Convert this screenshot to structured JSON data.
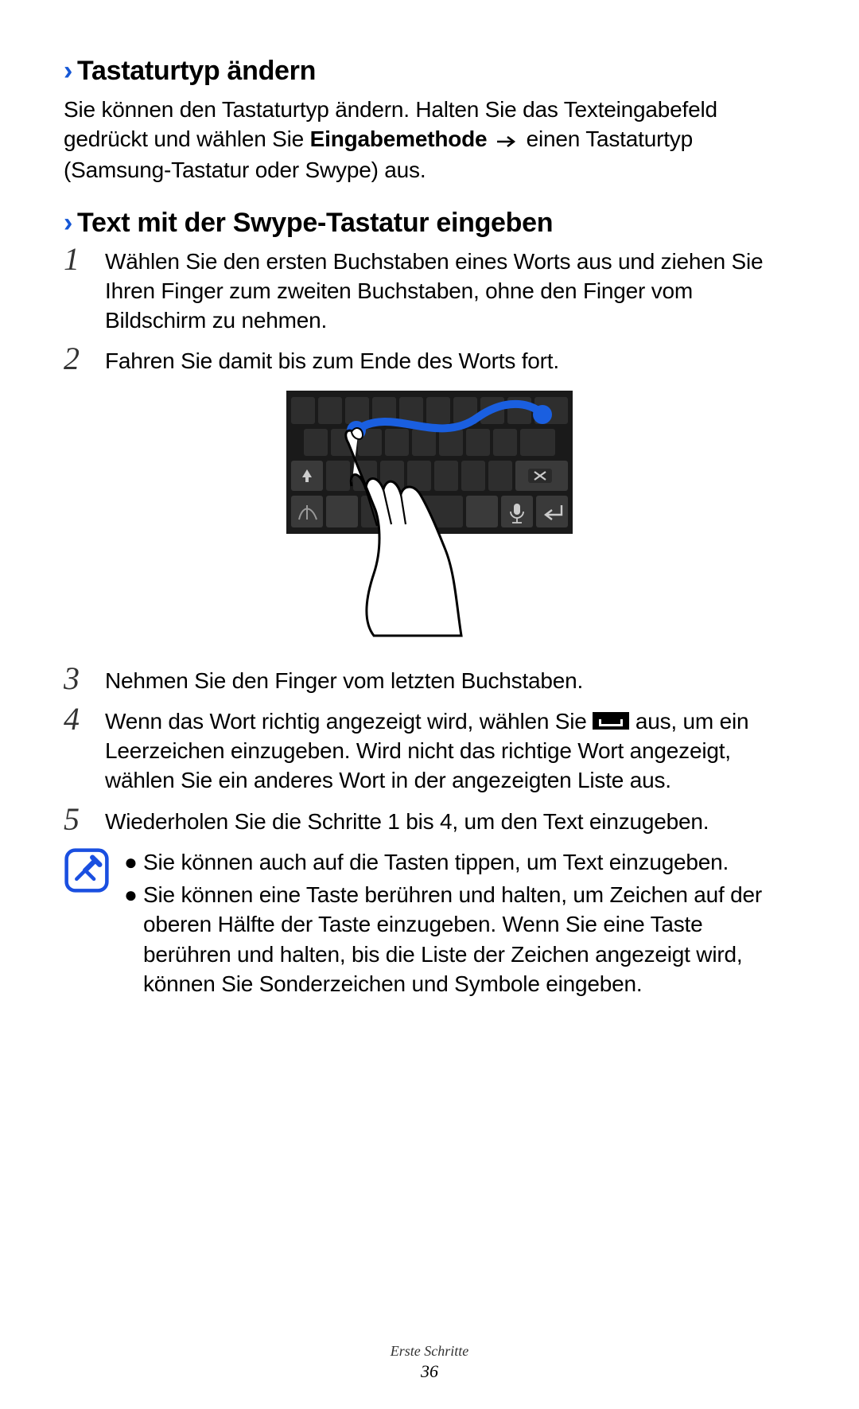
{
  "section1": {
    "chevron": "›",
    "title": "Tastaturtyp ändern",
    "p_pre": "Sie können den Tastaturtyp ändern. Halten Sie das Texteingabefeld gedrückt und wählen Sie ",
    "p_bold": "Eingabemethode",
    "p_post": " einen Tastaturtyp (Samsung-Tastatur oder Swype) aus."
  },
  "section2": {
    "chevron": "›",
    "title": "Text mit der Swype-Tastatur eingeben",
    "steps": {
      "n1": "1",
      "t1": "Wählen Sie den ersten Buchstaben eines Worts aus und ziehen Sie Ihren Finger zum zweiten Buchstaben, ohne den Finger vom Bildschirm zu nehmen.",
      "n2": "2",
      "t2": "Fahren Sie damit bis zum Ende des Worts fort.",
      "n3": "3",
      "t3": "Nehmen Sie den Finger vom letzten Buchstaben.",
      "n4": "4",
      "t4_pre": "Wenn das Wort richtig angezeigt wird, wählen Sie ",
      "t4_post": " aus, um ein Leerzeichen einzugeben. Wird nicht das richtige Wort angezeigt, wählen Sie ein anderes Wort in der angezeigten Liste aus.",
      "n5": "5",
      "t5": "Wiederholen Sie die Schritte 1 bis 4, um den Text einzugeben."
    },
    "note": {
      "b1": "Sie können auch auf die Tasten tippen, um Text einzugeben.",
      "b2": "Sie können eine Taste berühren und halten, um Zeichen auf der oberen Hälfte der Taste einzugeben. Wenn Sie eine Taste berühren und halten, bis die Liste der Zeichen angezeigt wird, können Sie Sonderzeichen und Symbole eingeben."
    }
  },
  "footer": {
    "section_name": "Erste Schritte",
    "page_num": "36"
  },
  "bullets": {
    "dot": "●"
  }
}
